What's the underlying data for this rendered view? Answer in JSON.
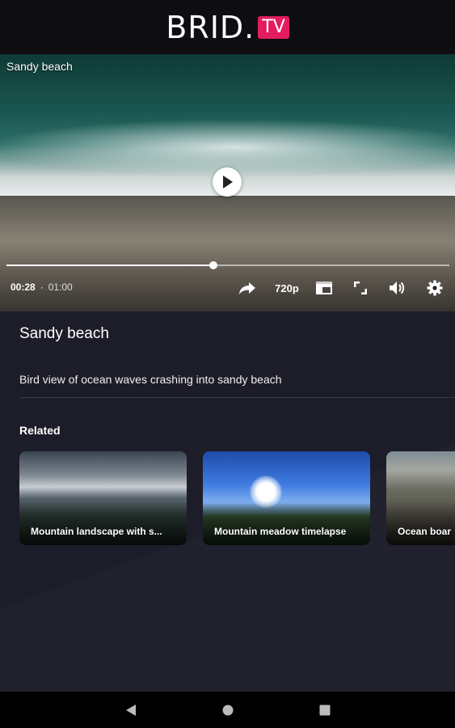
{
  "header": {
    "logo_text": "BRID.",
    "logo_badge": "TV",
    "brand_color": "#e31b5f"
  },
  "player": {
    "overlay_title": "Sandy beach",
    "current_time": "00:28",
    "separator": "·",
    "duration": "01:00",
    "progress_fraction": 0.467,
    "quality_label": "720p",
    "icons": [
      "play-icon",
      "share-icon",
      "picture-in-picture-icon",
      "fullscreen-icon",
      "volume-icon",
      "settings-icon"
    ]
  },
  "video_info": {
    "title": "Sandy beach",
    "description": "Bird view of ocean waves crashing into sandy beach"
  },
  "related": {
    "heading": "Related",
    "items": [
      {
        "title": "Mountain landscape with s..."
      },
      {
        "title": "Mountain meadow timelapse"
      },
      {
        "title": "Ocean boar"
      }
    ]
  },
  "navbar": {
    "icons": [
      "back-icon",
      "home-icon",
      "recents-icon"
    ]
  }
}
